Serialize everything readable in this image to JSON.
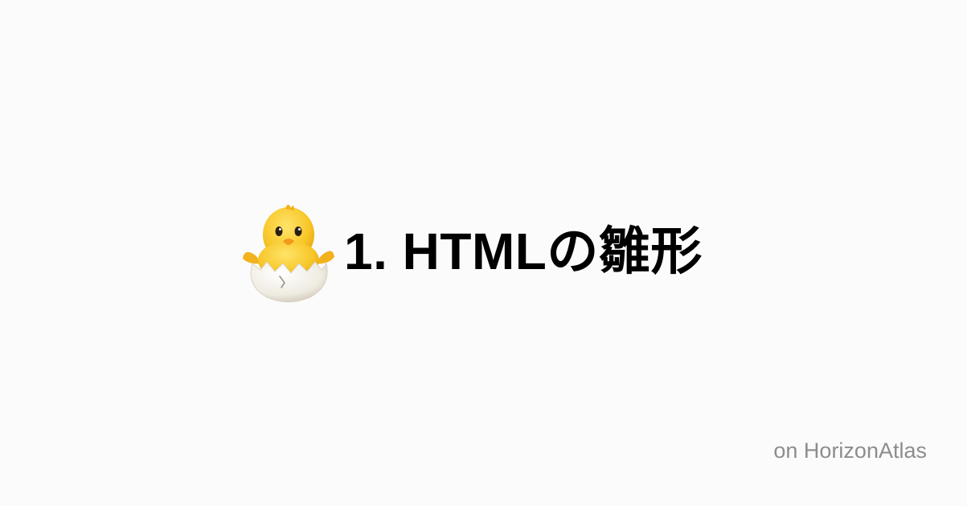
{
  "header": {
    "icon": "hatching-chick-icon",
    "title": "1. HTMLの雛形"
  },
  "footer": {
    "credit": "on HorizonAtlas"
  },
  "colors": {
    "background": "#fbfbfb",
    "title": "#000000",
    "credit": "#8d8d8d",
    "chick_body": "#f7c627",
    "chick_beak": "#f39a1c",
    "egg_shell": "#f4f1ea"
  }
}
